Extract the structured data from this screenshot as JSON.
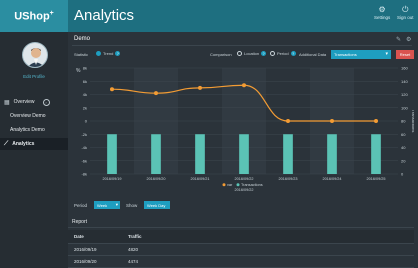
{
  "app": {
    "logo": "UShop",
    "logo_sup": "+",
    "title": "Analytics"
  },
  "top_actions": [
    {
      "icon": "gear-icon",
      "label": "Settings",
      "glyph": "⚙"
    },
    {
      "icon": "signout-icon",
      "label": "Sign out",
      "glyph": "⏻"
    }
  ],
  "sidebar": {
    "edit_profile": "Edit Profile",
    "items": [
      {
        "label": "Overview",
        "icon": "grid-icon"
      },
      {
        "label": "Overview Demo"
      },
      {
        "label": "Analytics Demo"
      },
      {
        "label": "Analytics",
        "icon": "trend-icon",
        "active": true
      }
    ]
  },
  "panel": {
    "title": "Demo",
    "statistic_label": "Statistic",
    "statistic_option": "Trend",
    "comparison_label": "Comparison",
    "comparison_options": [
      "Location",
      "Period"
    ],
    "additional_label": "Additional Data",
    "additional_value": "Transactions",
    "reset_label": "Reset",
    "period_label": "Period",
    "period_value": "Week",
    "show_label": "Show",
    "show_value": "Week Day"
  },
  "chart_data": {
    "type": "bar+line",
    "categories": [
      "2016/09/19",
      "2016/09/20",
      "2016/09/21",
      "2016/09/22",
      "2016/09/23",
      "2016/09/24",
      "2016/09/25"
    ],
    "series": [
      {
        "name": "Transactions",
        "kind": "bar",
        "axis": "right",
        "values": [
          60,
          60,
          60,
          60,
          60,
          60,
          60
        ],
        "color": "#5bc3b5"
      },
      {
        "name": "var",
        "kind": "line",
        "axis": "left",
        "values": [
          4.8,
          4.2,
          5.0,
          5.4,
          0,
          0,
          0
        ],
        "color": "#f39c34"
      }
    ],
    "y_left": {
      "label": "%",
      "ticks": [
        "8k",
        "6k",
        "4k",
        "2k",
        "0",
        "-2k",
        "-4k",
        "-6k",
        "-8k"
      ],
      "ylim": [
        -8,
        8
      ]
    },
    "y_right": {
      "label": "Transactions",
      "ticks": [
        "160",
        "140",
        "120",
        "100",
        "80",
        "60",
        "40",
        "20",
        "0"
      ],
      "ylim": [
        0,
        160
      ]
    },
    "legend": [
      "var",
      "Transactions"
    ],
    "x_label_extra": "2016/09/22",
    "grid": true
  },
  "report": {
    "title": "Report",
    "columns": [
      "Date",
      "Traffic"
    ],
    "rows": [
      [
        "2016/09/19",
        "4820"
      ],
      [
        "2016/09/20",
        "4474"
      ]
    ]
  }
}
